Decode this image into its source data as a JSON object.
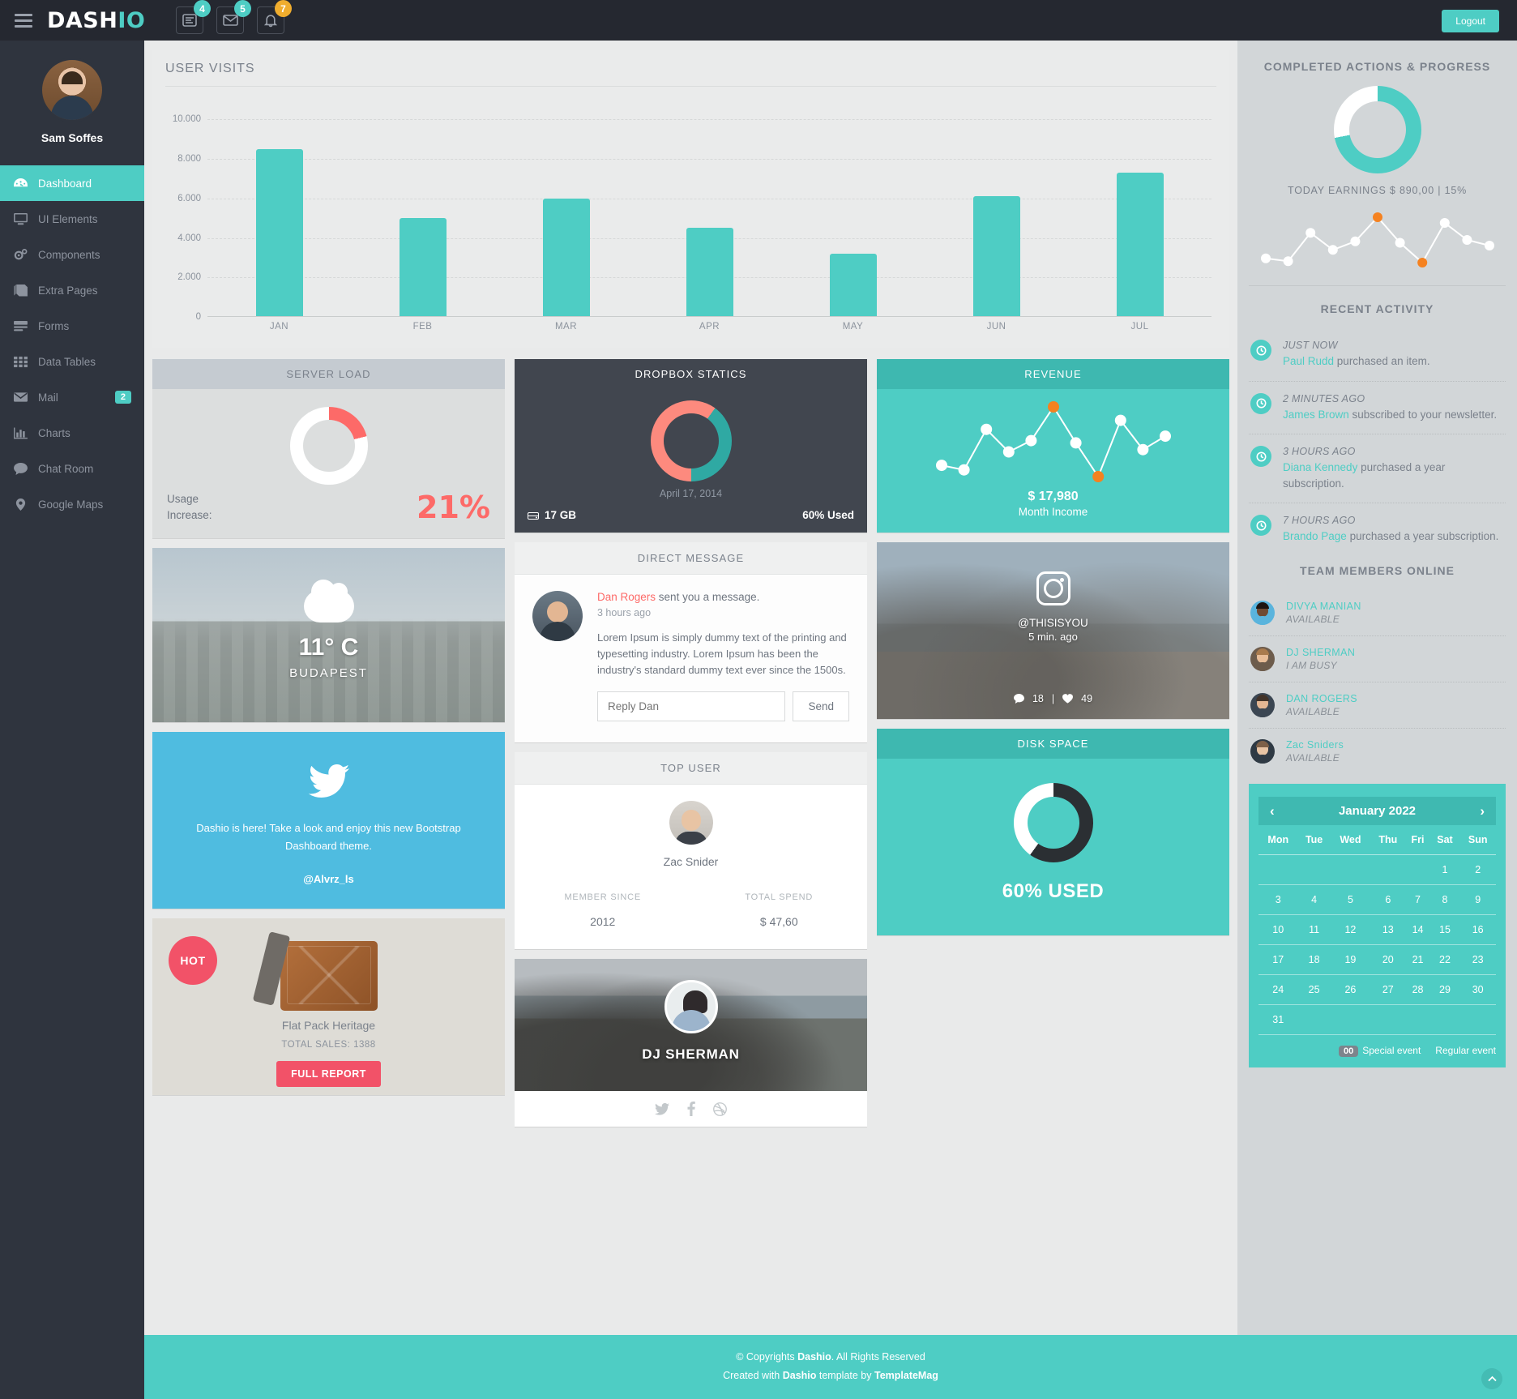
{
  "topbar": {
    "logo_a": "DASH",
    "logo_b": "IO",
    "icons": [
      {
        "name": "tasks-icon",
        "badge": "4",
        "badge_color": "#4ecdc4"
      },
      {
        "name": "envelope-icon",
        "badge": "5",
        "badge_color": "#4ecdc4"
      },
      {
        "name": "bell-icon",
        "badge": "7",
        "badge_color": "#f0ad2e"
      }
    ],
    "logout_label": "Logout"
  },
  "sidebar": {
    "user_name": "Sam Soffes",
    "items": [
      {
        "label": "Dashboard",
        "icon": "dashboard-icon",
        "active": true,
        "badge": ""
      },
      {
        "label": "UI Elements",
        "icon": "monitor-icon",
        "active": false,
        "badge": ""
      },
      {
        "label": "Components",
        "icon": "gears-icon",
        "active": false,
        "badge": ""
      },
      {
        "label": "Extra Pages",
        "icon": "book-icon",
        "active": false,
        "badge": ""
      },
      {
        "label": "Forms",
        "icon": "form-icon",
        "active": false,
        "badge": ""
      },
      {
        "label": "Data Tables",
        "icon": "table-icon",
        "active": false,
        "badge": ""
      },
      {
        "label": "Mail",
        "icon": "envelope-icon",
        "active": false,
        "badge": "2"
      },
      {
        "label": "Charts",
        "icon": "bar-chart-icon",
        "active": false,
        "badge": ""
      },
      {
        "label": "Chat Room",
        "icon": "comment-icon",
        "active": false,
        "badge": ""
      },
      {
        "label": "Google Maps",
        "icon": "map-pin-icon",
        "active": false,
        "badge": ""
      }
    ]
  },
  "chart_data": {
    "type": "bar",
    "title": "USER VISITS",
    "categories": [
      "JAN",
      "FEB",
      "MAR",
      "APR",
      "MAY",
      "JUN",
      "JUL"
    ],
    "values": [
      8500,
      5000,
      6000,
      4500,
      3200,
      6100,
      7300
    ],
    "ytick_labels": [
      "10.000",
      "8.000",
      "6.000",
      "4.000",
      "2.000",
      "0"
    ],
    "yticks": [
      10000,
      8000,
      6000,
      4000,
      2000,
      0
    ],
    "ylim": [
      0,
      11000
    ],
    "xlabel": "",
    "ylabel": "",
    "grid": true,
    "legend": false,
    "bar_color": "#4ecdc4"
  },
  "server_load": {
    "title": "SERVER LOAD",
    "usage_label": "Usage\nIncrease:",
    "usage_line1": "Usage",
    "usage_line2": "Increase:",
    "percent": "21%",
    "donut_value": 21,
    "donut_color": "#fd6a68",
    "donut_track": "#ffffff"
  },
  "dropbox": {
    "title": "DROPBOX STATICS",
    "date": "April 17, 2014",
    "size": "17 GB",
    "used": "60% Used",
    "slices": [
      {
        "name": "used",
        "value": 60,
        "color": "#fd8a7e"
      },
      {
        "name": "free",
        "value": 40,
        "color": "#2fa9a3"
      }
    ]
  },
  "revenue": {
    "title": "REVENUE",
    "amount": "$ 17,980",
    "subtitle": "Month Income",
    "points": [
      30,
      26,
      62,
      42,
      52,
      82,
      50,
      20,
      70,
      44,
      56
    ],
    "highlight_indices": [
      5,
      7
    ],
    "highlight_color": "#f58220"
  },
  "weather": {
    "temp": "11° C",
    "city": "BUDAPEST",
    "icon": "cloud-icon"
  },
  "direct_message": {
    "title": "DIRECT MESSAGE",
    "sender": "Dan Rogers",
    "sent_suffix": " sent you a message.",
    "time": "3 hours ago",
    "body": "Lorem Ipsum is simply dummy text of the printing and typesetting industry. Lorem Ipsum has been the industry's standard dummy text ever since the 1500s.",
    "reply_placeholder": "Reply Dan",
    "reply_value": "",
    "send_label": "Send"
  },
  "twitter": {
    "icon": "twitter-icon",
    "text": "Dashio is here! Take a look and enjoy this new Bootstrap Dashboard theme.",
    "handle": "@Alvrz_ls",
    "color": "#4fbce0"
  },
  "top_user": {
    "title": "TOP USER",
    "name": "Zac Snider",
    "stat1_label": "MEMBER SINCE",
    "stat1_value": "2012",
    "stat2_label": "TOTAL SPEND",
    "stat2_value": "$ 47,60"
  },
  "instagram": {
    "icon": "instagram-icon",
    "user": "@THISISYOU",
    "time": "5 min. ago",
    "comments": "18",
    "likes": "49"
  },
  "product": {
    "badge": "HOT",
    "name": "Flat Pack Heritage",
    "sales": "TOTAL SALES: 1388",
    "button": "FULL REPORT"
  },
  "dj_card": {
    "name": "DJ SHERMAN",
    "socials": [
      "twitter-icon",
      "facebook-icon",
      "dribbble-icon"
    ]
  },
  "disk_space": {
    "title": "DISK SPACE",
    "label": "60% USED",
    "value": 60,
    "used_color": "#2b2f33",
    "free_color": "#ffffff"
  },
  "rail": {
    "progress_title": "COMPLETED ACTIONS & PROGRESS",
    "progress_value": 72,
    "progress_color": "#4ecdc4",
    "progress_track": "#ffffff",
    "earnings": "TODAY EARNINGS $ 890,00 | 15%",
    "spark_points": [
      22,
      18,
      58,
      34,
      46,
      80,
      44,
      16,
      72,
      48,
      40
    ],
    "spark_highlight": [
      5,
      7
    ],
    "activity_title": "RECENT ACTIVITY",
    "activities": [
      {
        "time": "JUST NOW",
        "who": "Paul Rudd",
        "what": " purchased an item."
      },
      {
        "time": "2 MINUTES AGO",
        "who": "James Brown",
        "what": " subscribed to your newsletter."
      },
      {
        "time": "3 HOURS AGO",
        "who": "Diana Kennedy",
        "what": " purchased a year subscription."
      },
      {
        "time": "7 HOURS AGO",
        "who": "Brando Page",
        "what": " purchased a year subscription."
      }
    ],
    "team_title": "TEAM MEMBERS ONLINE",
    "team": [
      {
        "name": "DIVYA MANIAN",
        "status": "AVAILABLE",
        "skin": "#6f4a33",
        "hair": "#1d1512",
        "shirt": "#5ab4dd"
      },
      {
        "name": "DJ SHERMAN",
        "status": "I AM BUSY",
        "skin": "#e8bd98",
        "hair": "#a97b4e",
        "shirt": "#6d5c4c"
      },
      {
        "name": "DAN ROGERS",
        "status": "AVAILABLE",
        "skin": "#e3b693",
        "hair": "#43342a",
        "shirt": "#3b4652"
      },
      {
        "name": "Zac Sniders",
        "status": "AVAILABLE",
        "skin": "#e8c4a4",
        "hair": "#7d6048",
        "shirt": "#2f3a44"
      }
    ]
  },
  "calendar": {
    "month": "January 2022",
    "prev": "‹",
    "next": "›",
    "weekdays": [
      "Mon",
      "Tue",
      "Wed",
      "Thu",
      "Fri",
      "Sat",
      "Sun"
    ],
    "weeks": [
      [
        "",
        "",
        "",
        "",
        "",
        "1",
        "2"
      ],
      [
        "3",
        "4",
        "5",
        "6",
        "7",
        "8",
        "9"
      ],
      [
        "10",
        "11",
        "12",
        "13",
        "14",
        "15",
        "16"
      ],
      [
        "17",
        "18",
        "19",
        "20",
        "21",
        "22",
        "23"
      ],
      [
        "24",
        "25",
        "26",
        "27",
        "28",
        "29",
        "30"
      ],
      [
        "31",
        "",
        "",
        "",
        "",
        "",
        ""
      ]
    ],
    "legend_badge": "00",
    "legend_special": "Special event",
    "legend_regular": "Regular event"
  },
  "footer": {
    "line1_pre": "© Copyrights ",
    "line1_brand": "Dashio",
    "line1_post": ". All Rights Reserved",
    "line2_pre": "Created with ",
    "line2_brand": "Dashio",
    "line2_mid": " template by ",
    "line2_brand2": "TemplateMag"
  }
}
